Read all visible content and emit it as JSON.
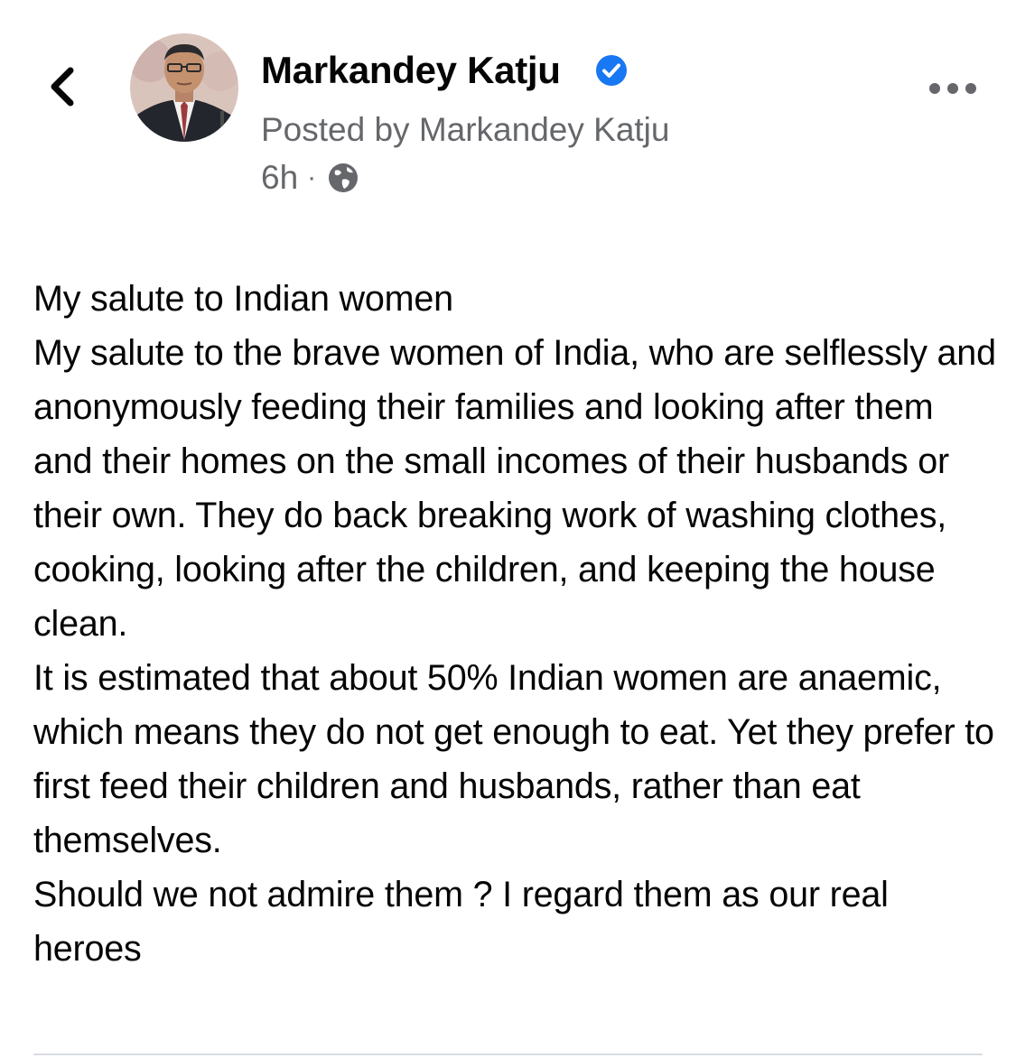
{
  "post": {
    "author_name": "Markandey Katju",
    "posted_by": "Posted by Markandey Katju",
    "time": "6h",
    "meta_separator": "·",
    "paragraphs": [
      "My salute to Indian women",
      "My salute to the brave women of India, who are selflessly and anonymously feeding their families and looking after them and their homes on the small incomes of their husbands or their own. They do back breaking work of washing clothes, cooking, looking after the children, and keeping the house clean.",
      "It is estimated that about 50% Indian women are anaemic, which means they do not get enough to eat. Yet they prefer to first feed their children and husbands, rather than eat themselves.",
      "Should we not admire them ? I regard them as our real heroes"
    ]
  },
  "icons": {
    "back": "chevron-left-icon",
    "verified": "verified-badge-icon",
    "audience": "globe-icon",
    "more": "more-horizontal-icon"
  },
  "colors": {
    "text_primary": "#050505",
    "text_secondary": "#65676b",
    "verified_blue": "#1877f2",
    "divider": "#dadde1"
  }
}
